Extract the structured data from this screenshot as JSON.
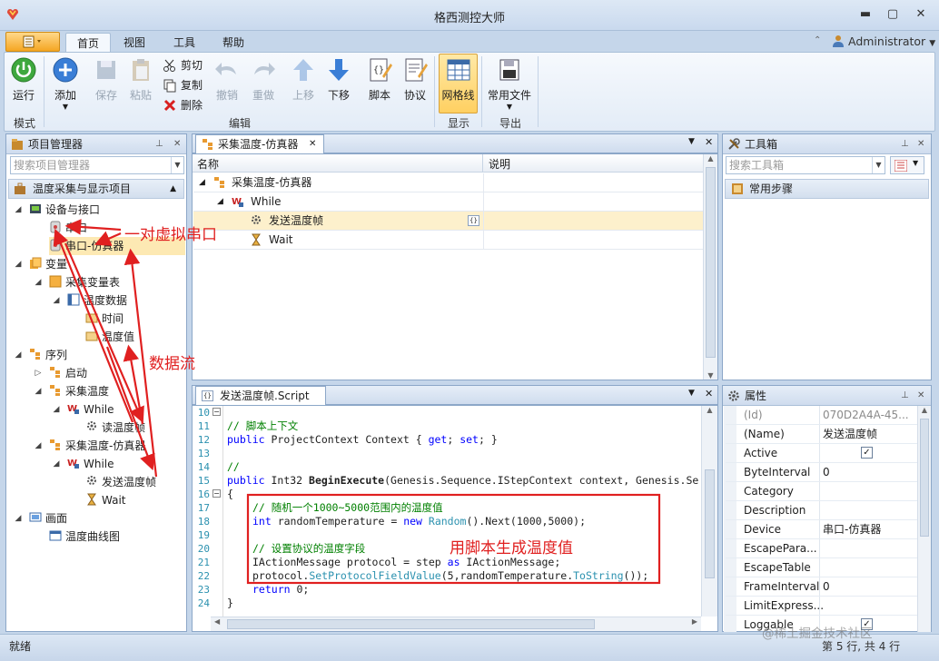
{
  "window": {
    "title": "格西测控大师"
  },
  "ribbon_tabs": [
    "首页",
    "视图",
    "工具",
    "帮助"
  ],
  "user": {
    "name": "Administrator"
  },
  "ribbon": {
    "run": "运行",
    "add": "添加",
    "save": "保存",
    "paste": "粘贴",
    "cut": "剪切",
    "copy": "复制",
    "delete": "删除",
    "undo": "撤销",
    "redo": "重做",
    "move_up": "上移",
    "move_down": "下移",
    "script": "脚本",
    "protocol": "协议",
    "grid": "网格线",
    "common_files": "常用文件",
    "groups": {
      "mode": "模式",
      "edit": "编辑",
      "display": "显示",
      "export": "导出"
    }
  },
  "project_manager": {
    "title": "项目管理器",
    "search_placeholder": "搜索项目管理器",
    "section": "温度采集与显示项目",
    "tree": {
      "devices": "设备与接口",
      "serial": "串口",
      "serial_sim": "串口-仿真器",
      "variables": "变量",
      "var_table": "采集变量表",
      "temp_data": "温度数据",
      "time": "时间",
      "temp_value": "温度值",
      "sequences": "序列",
      "start": "启动",
      "collect": "采集温度",
      "while1": "While",
      "read_frame": "读温度帧",
      "collect_sim": "采集温度-仿真器",
      "while2": "While",
      "send_frame": "发送温度帧",
      "wait": "Wait",
      "screens": "画面",
      "curve": "温度曲线图"
    }
  },
  "sequence_doc": {
    "tab": "采集温度-仿真器",
    "columns": [
      "名称",
      "说明"
    ],
    "rows": [
      "采集温度-仿真器",
      "While",
      "发送温度帧",
      "Wait"
    ]
  },
  "script_doc": {
    "tab": "发送温度帧.Script",
    "line_numbers": [
      "10",
      "11",
      "12",
      "13",
      "14",
      "15",
      "16",
      "17",
      "18",
      "19",
      "20",
      "21",
      "22",
      "23",
      "24"
    ]
  },
  "toolbox": {
    "title": "工具箱",
    "search_placeholder": "搜索工具箱",
    "section": "常用步骤"
  },
  "properties": {
    "title": "属性",
    "rows": [
      {
        "name": "(Id)",
        "value": "070D2A4A-45..."
      },
      {
        "name": "(Name)",
        "value": "发送温度帧"
      },
      {
        "name": "Active",
        "value": ""
      },
      {
        "name": "ByteInterval",
        "value": "0"
      },
      {
        "name": "Category",
        "value": ""
      },
      {
        "name": "Description",
        "value": ""
      },
      {
        "name": "Device",
        "value": "串口-仿真器"
      },
      {
        "name": "EscapePara...",
        "value": ""
      },
      {
        "name": "EscapeTable",
        "value": ""
      },
      {
        "name": "FrameInterval",
        "value": "0"
      },
      {
        "name": "LimitExpress...",
        "value": ""
      },
      {
        "name": "Loggable",
        "value": ""
      }
    ]
  },
  "annotations": {
    "virtual_ports": "一对虚拟串口",
    "data_flow": "数据流",
    "script_gen": "用脚本生成温度值"
  },
  "status": {
    "left": "就绪",
    "right": "第 5 行, 共 4 行"
  },
  "watermark": "@稀土掘金技术社区"
}
